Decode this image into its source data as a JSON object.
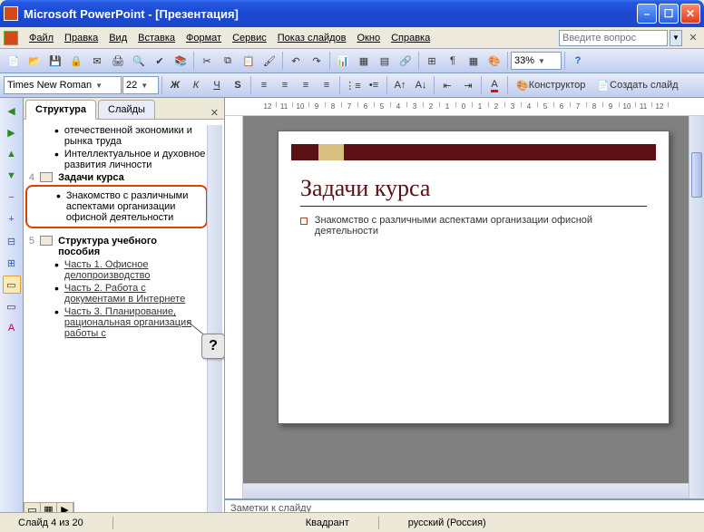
{
  "window": {
    "title": "Microsoft PowerPoint - [Презентация]"
  },
  "menu": {
    "items": [
      "Файл",
      "Правка",
      "Вид",
      "Вставка",
      "Формат",
      "Сервис",
      "Показ слайдов",
      "Окно",
      "Справка"
    ],
    "help_placeholder": "Введите вопрос"
  },
  "toolbar1": {
    "zoom": "33%"
  },
  "toolbar2": {
    "font": "Times New Roman",
    "size": "22",
    "designer": "Конструктор",
    "newslide": "Создать слайд"
  },
  "tabs": {
    "outline": "Структура",
    "slides": "Слайды"
  },
  "outline": {
    "pre_bullets": [
      "отечественной экономики и рынка труда",
      "Интеллектуальное и духовное развития личности"
    ],
    "slide4": {
      "num": "4",
      "title": "Задачи курса",
      "bullets": [
        "Знакомство с различными аспектами организации офисной деятельности"
      ]
    },
    "slide5": {
      "num": "5",
      "title": "Структура учебного пособия",
      "bullets": [
        "Часть 1. Офисное делопроизводство",
        "Часть 2. Работа с документами в Интернете",
        "Часть 3. Планирование, рациональная организация работы с"
      ]
    },
    "question": "?"
  },
  "slide_canvas": {
    "title": "Задачи курса",
    "body": "Знакомство с различными аспектами организации офисной деятельности"
  },
  "notes": {
    "placeholder": "Заметки к слайду"
  },
  "ruler_h": [
    "12",
    "11",
    "10",
    "9",
    "8",
    "7",
    "6",
    "5",
    "4",
    "3",
    "2",
    "1",
    "0",
    "1",
    "2",
    "3",
    "4",
    "5",
    "6",
    "7",
    "8",
    "9",
    "10",
    "11",
    "12"
  ],
  "statusbar": {
    "slide": "Слайд 4 из 20",
    "design": "Квадрант",
    "lang": "русский (Россия)"
  }
}
